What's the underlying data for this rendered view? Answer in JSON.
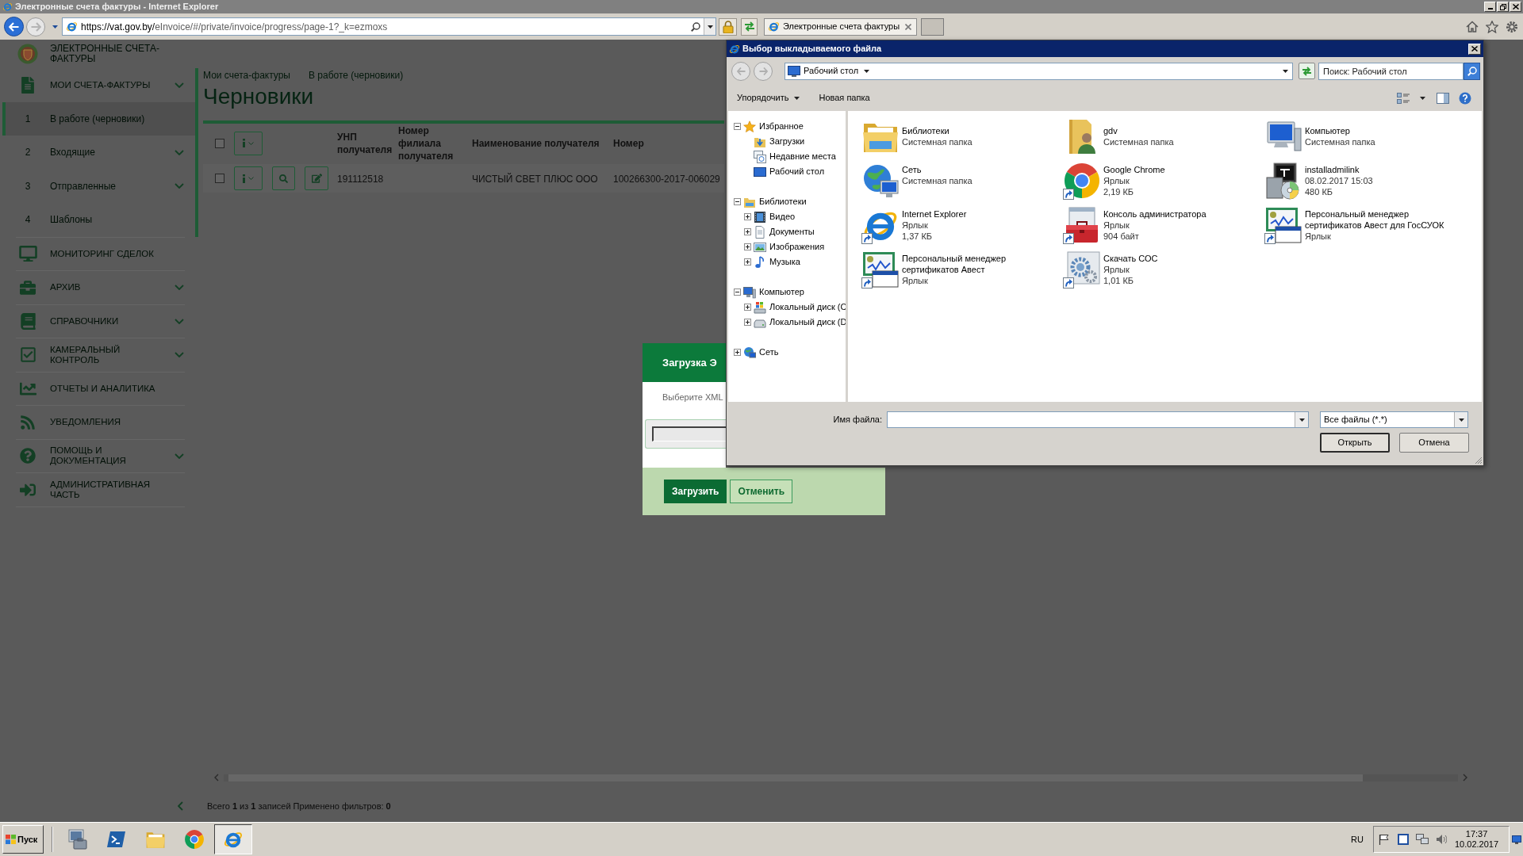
{
  "window": {
    "title": "Электронные счета фактуры - Internet Explorer"
  },
  "browser": {
    "address": {
      "domain": "https://vat.gov.by/",
      "path": "eInvoice/#/private/invoice/progress/page-1?_k=ezmoxs"
    },
    "tabs": [
      {
        "title": "Электронные счета фактуры",
        "selected": true
      }
    ]
  },
  "sidebar": {
    "brand": "ЭЛЕКТРОННЫЕ СЧЕТА-ФАКТУРЫ",
    "items": [
      {
        "label": "МОИ СЧЕТА-ФАКТУРЫ",
        "expandable": true,
        "selected": false,
        "children": [
          {
            "number": "1",
            "label": "В работе (черновики)",
            "expandable": false,
            "selected": true
          },
          {
            "number": "2",
            "label": "Входящие",
            "expandable": true,
            "selected": false
          },
          {
            "number": "3",
            "label": "Отправленные",
            "expandable": true,
            "selected": false
          },
          {
            "number": "4",
            "label": "Шаблоны",
            "expandable": false,
            "selected": false
          }
        ]
      },
      {
        "label": "МОНИТОРИНГ СДЕЛОК",
        "expandable": false,
        "selected": false
      },
      {
        "label": "АРХИВ",
        "expandable": true,
        "selected": false
      },
      {
        "label": "СПРАВОЧНИКИ",
        "expandable": true,
        "selected": false
      },
      {
        "label": "КАМЕРАЛЬНЫЙ КОНТРОЛЬ",
        "expandable": true,
        "selected": false
      },
      {
        "label": "ОТЧЕТЫ И АНАЛИТИКА",
        "expandable": false,
        "selected": false
      },
      {
        "label": "УВЕДОМЛЕНИЯ",
        "expandable": false,
        "selected": false
      },
      {
        "label": "ПОМОЩЬ И ДОКУМЕНТАЦИЯ",
        "expandable": true,
        "selected": false
      },
      {
        "label": "АДМИНИСТРАТИВНАЯ ЧАСТЬ",
        "expandable": false,
        "selected": false
      }
    ]
  },
  "page": {
    "breadcrumbs": [
      "Мои счета-фактуры",
      "В работе (черновики)"
    ],
    "title": "Черновики",
    "table": {
      "select_all": {
        "checked": false
      },
      "columns": [
        "УНП получателя",
        "Номер филиала получателя",
        "Наименование получателя",
        "Номер"
      ],
      "rows": [
        {
          "checked": false,
          "recipient_unp": "191112518",
          "recipient_name": "ЧИСТЫЙ СВЕТ ПЛЮС ООО",
          "number": "100266300-2017-006029"
        }
      ]
    },
    "status": "Всего **1** из **1** записей Применено фильтров: **0**"
  },
  "upload_dialog": {
    "title": "Загрузка Э",
    "prompt": "Выберите XML",
    "buttons": [
      {
        "label": "Загрузить",
        "kind": "primary"
      },
      {
        "label": "Отменить",
        "kind": "secondary"
      }
    ]
  },
  "file_dialog": {
    "title": "Выбор выкладываемого файла",
    "location": "Рабочий стол",
    "search": {
      "placeholder": "Поиск: Рабочий стол"
    },
    "toolbar": [
      {
        "label": "Упорядочить",
        "menu": true
      },
      {
        "label": "Новая папка",
        "menu": false
      }
    ],
    "tree": [
      {
        "label": "Избранное",
        "expanded": true,
        "children": [
          {
            "label": "Загрузки"
          },
          {
            "label": "Недавние места"
          },
          {
            "label": "Рабочий стол"
          }
        ]
      },
      {
        "label": "Библиотеки",
        "expanded": true,
        "children": [
          {
            "label": "Видео",
            "expanded": false
          },
          {
            "label": "Документы",
            "expanded": false
          },
          {
            "label": "Изображения",
            "expanded": false
          },
          {
            "label": "Музыка",
            "expanded": false
          }
        ]
      },
      {
        "label": "Компьютер",
        "expanded": true,
        "children": [
          {
            "label": "Локальный диск (C",
            "expanded": false
          },
          {
            "label": "Локальный диск (D",
            "expanded": false
          }
        ]
      },
      {
        "label": "Сеть",
        "expanded": false
      }
    ],
    "files": [
      {
        "name": "Библиотеки",
        "details": [
          "Системная папка"
        ],
        "shortcut": false
      },
      {
        "name": "gdv",
        "details": [
          "Системная папка"
        ],
        "shortcut": false
      },
      {
        "name": "Компьютер",
        "details": [
          "Системная папка"
        ],
        "shortcut": false
      },
      {
        "name": "Сеть",
        "details": [
          "Системная папка"
        ],
        "shortcut": false
      },
      {
        "name": "Google Chrome",
        "details": [
          "Ярлык",
          "2,19 КБ"
        ],
        "shortcut": true
      },
      {
        "name": "installadmilink",
        "details": [
          "08.02.2017 15:03",
          "480 КБ"
        ],
        "shortcut": false
      },
      {
        "name": "Internet Explorer",
        "details": [
          "Ярлык",
          "1,37 КБ"
        ],
        "shortcut": true
      },
      {
        "name": "Консоль администратора",
        "details": [
          "Ярлык",
          "904 байт"
        ],
        "shortcut": true
      },
      {
        "name": "Персональный менеджер сертификатов Авест для ГосСУОК",
        "details": [
          "Ярлык"
        ],
        "shortcut": true
      },
      {
        "name": "Персональный менеджер сертификатов Авест",
        "details": [
          "Ярлык"
        ],
        "shortcut": true
      },
      {
        "name": "Скачать СОС",
        "details": [
          "Ярлык",
          "1,01 КБ"
        ],
        "shortcut": true
      }
    ],
    "file_name": {
      "label": "Имя файла:"
    },
    "file_type": "Все файлы (*.*)",
    "buttons": [
      {
        "label": "Открыть",
        "default": true
      },
      {
        "label": "Отмена",
        "default": false
      }
    ]
  },
  "taskbar": {
    "start": "Пуск",
    "apps": [
      {
        "selected": false
      },
      {
        "selected": false
      },
      {
        "selected": false
      },
      {
        "selected": false
      },
      {
        "selected": true
      }
    ],
    "language": "RU",
    "time": "17:37",
    "date": "10.02.2017"
  }
}
